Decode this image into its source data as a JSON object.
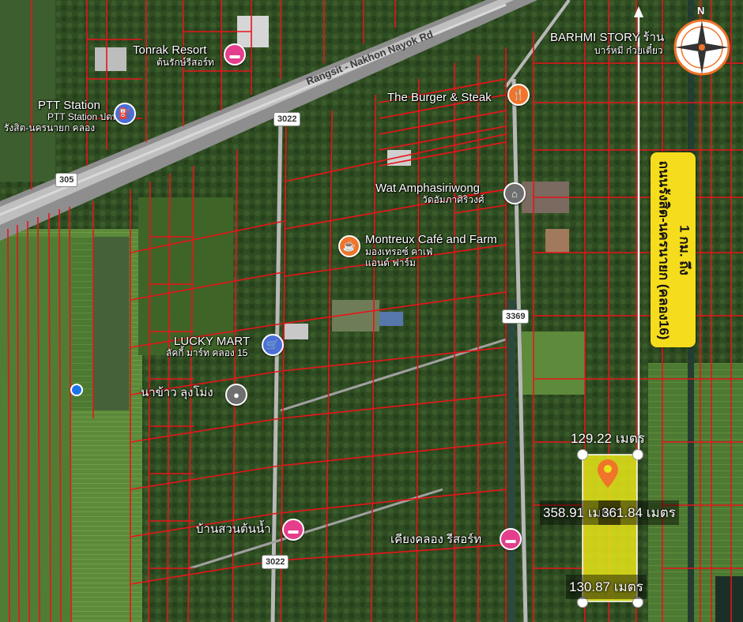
{
  "map": {
    "roads": {
      "highway_name": "Rangsit - Nakhon Nayok Rd",
      "shield_305": "305",
      "shield_3022_top": "3022",
      "shield_3022_bottom": "3022",
      "shield_3369": "3369"
    },
    "places": [
      {
        "name": "Tonrak Resort",
        "sub": "ต้นรักษ์รีสอร์ท",
        "icon": "hotel-icon"
      },
      {
        "name": "PTT Station",
        "sub": "PTT Station ปตท.",
        "sub2": "รังสิต-นครนายก คลอง",
        "icon": "fuel-icon"
      },
      {
        "name": "BARHMI STORY ร้าน",
        "sub": "บาร์หมี่ ก๋วยเตี๋ยว",
        "icon": "restaurant-icon"
      },
      {
        "name": "The Burger & Steak",
        "icon": "food-icon"
      },
      {
        "name": "Wat Amphasiriwong",
        "sub": "วัดอัมภาศิริวงศ์",
        "icon": "temple-icon"
      },
      {
        "name": "Montreux Café and Farm",
        "sub": "มองเทรอซ์ คาเฟ่",
        "sub2": "แอนด์ ฟาร์ม",
        "icon": "cafe-icon"
      },
      {
        "name": "LUCKY MART",
        "sub": "ลัคกี้ มาร์ท คลอง 15",
        "icon": "shop-icon"
      },
      {
        "name": "นาข้าว ลุงโม่ง",
        "icon": "place-icon"
      },
      {
        "name": "บ้านสวนต้นน้ำ",
        "icon": "hotel-icon"
      },
      {
        "name": "เคียงคลอง รีสอร์ท",
        "icon": "hotel-icon"
      }
    ],
    "measurements": {
      "top": "129.22 เมตร",
      "left": "358.91 เมตร",
      "right": "361.84 เมตร",
      "bottom": "130.87 เมตร"
    },
    "callout": {
      "line1": "1 กม. ถึง",
      "line2": "ถนนรังสิต-นครนายก (คลอง16)"
    },
    "compass": {
      "north": "N"
    },
    "colors": {
      "parcel_line": "#e8141a",
      "plot_fill": "#e6e619",
      "callout_bg": "#f5dc1c",
      "highway": "#c9c9c9",
      "marker_orange": "#f0742a"
    }
  }
}
